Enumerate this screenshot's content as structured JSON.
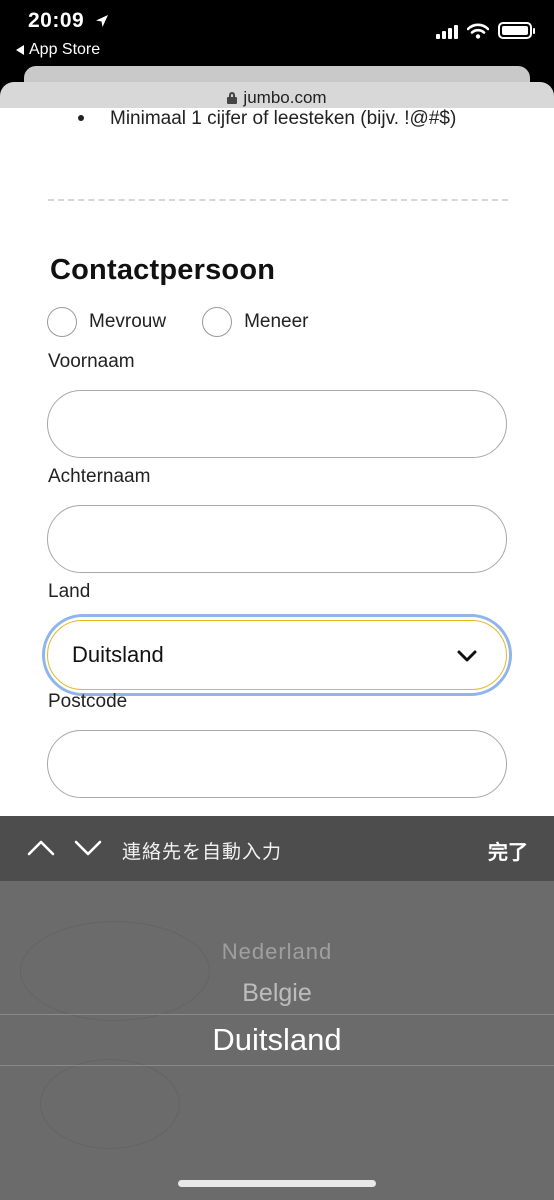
{
  "status_bar": {
    "time": "20:09",
    "back_label": "App Store"
  },
  "browser": {
    "url": "jumbo.com"
  },
  "page": {
    "password_rule": "Minimaal 1 cijfer of leesteken (bijv. !@#$)",
    "section_title": "Contactpersoon",
    "salutation_options": [
      "Mevrouw",
      "Meneer"
    ],
    "fields": {
      "first_name_label": "Voornaam",
      "first_name_value": "",
      "last_name_label": "Achternaam",
      "last_name_value": "",
      "country_label": "Land",
      "country_value": "Duitsland",
      "postcode_label": "Postcode",
      "postcode_value": ""
    }
  },
  "keyboard_toolbar": {
    "autofill_label": "連絡先を自動入力",
    "done_label": "完了"
  },
  "picker": {
    "options": [
      "Nederland",
      "Belgie",
      "Duitsland"
    ],
    "selected": "Duitsland"
  },
  "colors": {
    "focus_ring": "#8fb6ea",
    "select_border": "#e4b82a",
    "toolbar_bg": "#4d4d4d",
    "picker_bg": "#6b6b6b"
  },
  "icons": {
    "location": "location-arrow-icon",
    "lock": "lock-icon",
    "select_chevron": "chevron-down-icon",
    "previous_field": "chevron-up-icon",
    "next_field": "chevron-down-icon"
  }
}
